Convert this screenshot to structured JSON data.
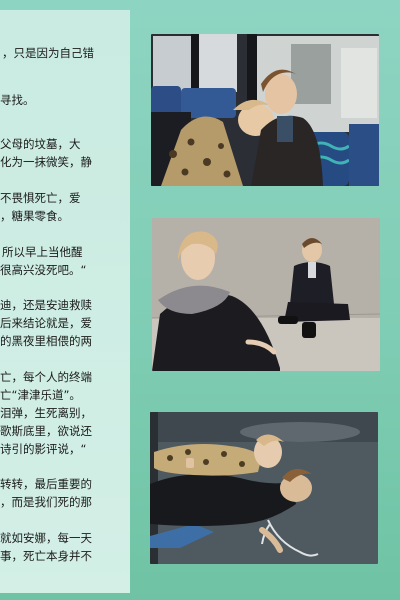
{
  "article": {
    "lines": [
      "，只是因为自己错",
      "寻找。",
      "父母的坟墓，大",
      "化为一抹微笑，静",
      "不畏惧死亡，爱",
      "，糖果零食。",
      "所以早上当他醒",
      "很高兴没死吧。“",
      "迪，还是安迪救赎",
      "后来结论就是，爱",
      "的黑夜里相偎的两",
      "亡，每个人的终端",
      "亡“津津乐道”。",
      "泪弹，生死离别，",
      "歌斯底里，欲说还",
      "诗引的影评说，“",
      "转转，最后重要的",
      "，而是我们死的那",
      "就如安娜，每一天",
      "事，死亡本身并不"
    ]
  },
  "photos": [
    {
      "name": "bus-scene-photo"
    },
    {
      "name": "wall-scene-photo"
    },
    {
      "name": "street-scene-photo"
    }
  ]
}
